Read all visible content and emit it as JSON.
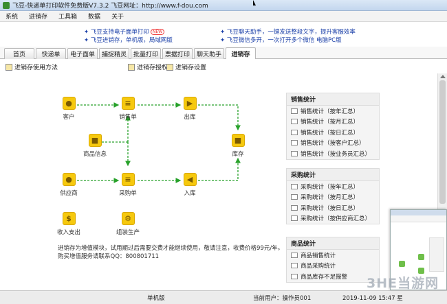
{
  "window": {
    "title": "飞豆-快递单打印软件免费版V7.3.2  飞豆网址：http://www.f-dou.com"
  },
  "menu": [
    "系统",
    "进销存",
    "工具箱",
    "数据",
    "关于"
  ],
  "banner": {
    "left_line1": "飞豆支持电子面单打印",
    "left_line1_badge": "NEW",
    "left_line2": "飞豆进销存，单机版，局域网版",
    "right_line1": "飞豆聊天助手，一键发送整段文字，提升客服效率",
    "right_line2": "飞豆微信多开，一次打开多个微信 电脑PC版"
  },
  "tabs": [
    "首页",
    "快递单",
    "电子面单",
    "捕捉精灵",
    "批量打印",
    "票据打印",
    "聊天助手",
    "进销存"
  ],
  "active_tab": "进销存",
  "toolbar": {
    "help": "进销存使用方法",
    "auth": "进销存授权",
    "settings": "进销存设置"
  },
  "flow": {
    "customer": "客户",
    "sales_order": "销售单",
    "outbound": "出库",
    "product_info": "商品信息",
    "warehouse": "库存",
    "supplier": "供应商",
    "purchase_order": "采购单",
    "inbound": "入库",
    "income_expense": "收入支出",
    "assembly": "组装生产"
  },
  "panels": {
    "sales": {
      "title": "销售统计",
      "items": [
        "销售统计（按年汇总）",
        "销售统计（按月汇总）",
        "销售统计（按日汇总）",
        "销售统计（按客户汇总）",
        "销售统计（按业务员汇总）"
      ]
    },
    "purchase": {
      "title": "采购统计",
      "items": [
        "采购统计（按年汇总）",
        "采购统计（按月汇总）",
        "采购统计（按日汇总）",
        "采购统计（按供应商汇总）"
      ]
    },
    "product": {
      "title": "商品统计",
      "items": [
        "商品销售统计",
        "商品采购统计",
        "商品库存不足报警"
      ]
    }
  },
  "notes": {
    "line1": "进销存为增值模块，试用期过后需要交费才能继续使用，敬请注意，收费价格99元/年。",
    "line2": "购买增值服务请联系QQ：800801711"
  },
  "status": {
    "edition": "单机版",
    "user": "当前用户：操作员001",
    "datetime": "2019-11-09 15:47 星"
  },
  "watermark": "3HE当游网"
}
